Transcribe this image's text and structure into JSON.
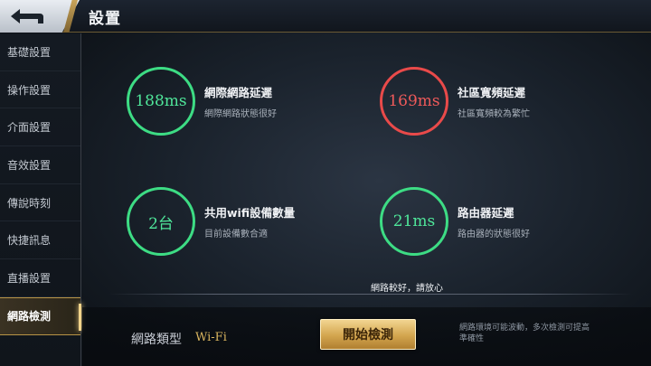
{
  "header": {
    "title": "設置",
    "back_icon": "back-arrow-icon"
  },
  "sidebar": {
    "items": [
      {
        "label": "基礎設置"
      },
      {
        "label": "操作設置"
      },
      {
        "label": "介面設置"
      },
      {
        "label": "音效設置"
      },
      {
        "label": "傳說時刻"
      },
      {
        "label": "快捷訊息"
      },
      {
        "label": "直播設置"
      },
      {
        "label": "網路檢測"
      }
    ],
    "active_index": 7
  },
  "metrics": [
    {
      "value": "188ms",
      "name": "網際網路延遲",
      "desc": "網際網路狀態很好",
      "status": "good"
    },
    {
      "value": "169ms",
      "name": "社區寬頻延遲",
      "desc": "社區寬頻較為繁忙",
      "status": "bad"
    },
    {
      "value": "2台",
      "name": "共用wifi設備數量",
      "desc": "目前設備數合適",
      "status": "good"
    },
    {
      "value": "21ms",
      "name": "路由器延遲",
      "desc": "路由器的狀態很好",
      "status": "good"
    }
  ],
  "status": {
    "message": "網路較好，請放心"
  },
  "bottom": {
    "network_type_label": "網路類型",
    "network_type_value": "Wi-Fi",
    "start_button": "開始檢測",
    "hint": "網路環境可能波動，多次檢測可提高準確性"
  },
  "colors": {
    "good": "#3ddc84",
    "bad": "#e94a4a",
    "accent_gold": "#d3a54e"
  }
}
